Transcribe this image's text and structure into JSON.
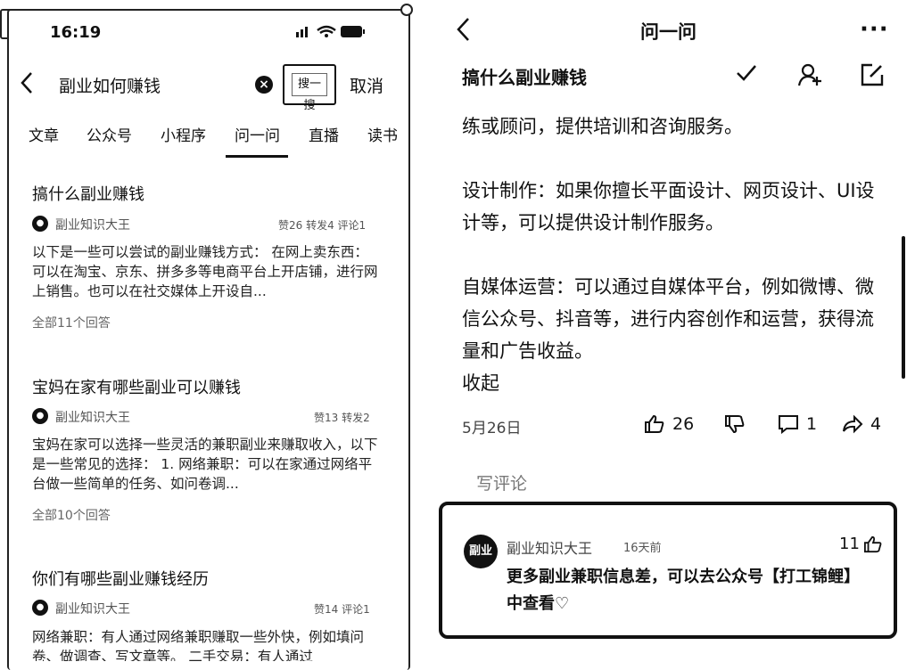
{
  "status_bar": {
    "time": "16:19"
  },
  "search": {
    "query": "副业如何赚钱",
    "button_label": "搜一搜",
    "cancel_label": "取消"
  },
  "tabs": [
    "文章",
    "公众号",
    "小程序",
    "问一问",
    "直播",
    "读书"
  ],
  "active_tab": "问一问",
  "results": [
    {
      "title": "搞什么副业赚钱",
      "author": "副业知识大王",
      "stats": "赞26 转发4 评论1",
      "excerpt": "以下是一些可以尝试的副业赚钱方式： 在网上卖东西：可以在淘宝、京东、拼多多等电商平台上开店铺，进行网上销售。也可以在社交媒体上开设自...",
      "all_answers": "全部11个回答"
    },
    {
      "title": "宝妈在家有哪些副业可以赚钱",
      "author": "副业知识大王",
      "stats": "赞13 转发2",
      "excerpt": "宝妈在家可以选择一些灵活的兼职副业来赚取收入，以下是一些常见的选择： 1. 网络兼职：可以在家通过网络平台做一些简单的任务、如问卷调...",
      "all_answers": "全部10个回答"
    },
    {
      "title": "你们有哪些副业赚钱经历",
      "author": "副业知识大王",
      "stats": "赞14 评论1",
      "excerpt": "网络兼职：有人通过网络兼职赚取一些外快，例如填问卷、做调查、写文章等。 二手交易：有人通过",
      "all_answers": ""
    }
  ],
  "detail": {
    "header_title": "问一问",
    "question": "搞什么副业赚钱",
    "paragraph_1": "练或顾问，提供培训和咨询服务。",
    "paragraph_2": "设计制作：如果你擅长平面设计、网页设计、UI设计等，可以提供设计制作服务。",
    "paragraph_3": "自媒体运营：可以通过自媒体平台，例如微博、微信公众号、抖音等，进行内容创作和运营，获得流量和广告收益。",
    "collapse_label": "收起",
    "date": "5月26日",
    "likes": "26",
    "dislikes": "",
    "comments": "1",
    "shares": "4",
    "write_comment": "写评论"
  },
  "comment": {
    "avatar_text": "副业",
    "author": "副业知识大王",
    "time": "16天前",
    "likes": "11",
    "text": "更多副业兼职信息差，可以去公众号【打工锦鲤】中查看♡"
  },
  "icons": {
    "status": "signal-wifi-battery-icons",
    "back": "chevron-left-icon",
    "clear": "clear-circle-icon",
    "check": "check-icon",
    "add_user": "add-user-icon",
    "edit": "edit-icon",
    "more": "more-dots-icon",
    "like": "thumbs-up-icon",
    "dislike": "thumbs-down-icon",
    "comment": "comment-bubble-icon",
    "share": "share-icon"
  }
}
